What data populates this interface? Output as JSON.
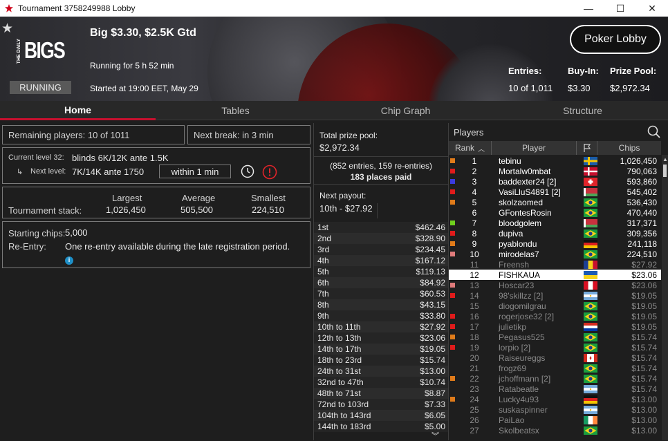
{
  "window": {
    "title": "Tournament 3758249988 Lobby",
    "minimize": "—",
    "maximize": "☐",
    "close": "✕"
  },
  "banner": {
    "brand_small": "THE DAILY",
    "brand_big": "BIGS",
    "status": "RUNNING",
    "title": "Big $3.30, $2.5K Gtd",
    "running_for": "Running for 5 h 52 min",
    "started": "Started at 19:00 EET, May 29",
    "lobby_button": "Poker Lobby",
    "entries_label": "Entries:",
    "entries_value": "10 of 1,011",
    "buyin_label": "Buy-In:",
    "buyin_value": "$3.30",
    "prize_label": "Prize Pool:",
    "prize_value": "$2,972.34"
  },
  "tabs": [
    "Home",
    "Tables",
    "Chip Graph",
    "Structure"
  ],
  "home": {
    "remaining": "Remaining players: 10 of 1011",
    "next_break": "Next break: in 3 min",
    "current_level_label": "Current level 32:",
    "current_level_value": "blinds 6K/12K ante 1.5K",
    "next_level_label": "Next level:",
    "next_level_value": "7K/14K ante 1750",
    "within": "within 1 min",
    "stack_header": {
      "largest": "Largest",
      "average": "Average",
      "smallest": "Smallest"
    },
    "stack_label": "Tournament stack:",
    "stack_values": {
      "largest": "1,026,450",
      "average": "505,500",
      "smallest": "224,510"
    },
    "starting_chips_label": "Starting chips:",
    "starting_chips_value": "5,000",
    "reentry_label": "Re-Entry:",
    "reentry_value": "One re-entry available during the late registration period."
  },
  "prize": {
    "total_label": "Total prize pool:",
    "total_value": "$2,972.34",
    "entries_note": "(852 entries, 159 re-entries)",
    "places_paid": "183 places paid",
    "next_payout_label": "Next payout:",
    "next_payout_value": "10th - $27.92",
    "list": [
      {
        "place": "1st",
        "amount": "$462.46"
      },
      {
        "place": "2nd",
        "amount": "$328.90"
      },
      {
        "place": "3rd",
        "amount": "$234.45"
      },
      {
        "place": "4th",
        "amount": "$167.12"
      },
      {
        "place": "5th",
        "amount": "$119.13"
      },
      {
        "place": "6th",
        "amount": "$84.92"
      },
      {
        "place": "7th",
        "amount": "$60.53"
      },
      {
        "place": "8th",
        "amount": "$43.15"
      },
      {
        "place": "9th",
        "amount": "$33.80"
      },
      {
        "place": "10th to 11th",
        "amount": "$27.92"
      },
      {
        "place": "12th to 13th",
        "amount": "$23.06"
      },
      {
        "place": "14th to 17th",
        "amount": "$19.05"
      },
      {
        "place": "18th to 23rd",
        "amount": "$15.74"
      },
      {
        "place": "24th to 31st",
        "amount": "$13.00"
      },
      {
        "place": "32nd to 47th",
        "amount": "$10.74"
      },
      {
        "place": "48th to 71st",
        "amount": "$8.87"
      },
      {
        "place": "72nd to 103rd",
        "amount": "$7.33"
      },
      {
        "place": "104th to 143rd",
        "amount": "$6.05"
      },
      {
        "place": "144th to 183rd",
        "amount": "$5.00"
      }
    ]
  },
  "players": {
    "header": "Players",
    "columns": {
      "rank": "Rank",
      "player": "Player",
      "chips": "Chips"
    },
    "rows": [
      {
        "rank": "1",
        "name": "tebinu",
        "chips": "1,026,450",
        "state": "act",
        "mark": "#e07b1a",
        "flag": "se"
      },
      {
        "rank": "2",
        "name": "Mortalw0mbat",
        "chips": "790,063",
        "state": "act",
        "mark": "#e01b1b",
        "flag": "dk"
      },
      {
        "rank": "3",
        "name": "baddexter24 [2]",
        "chips": "593,860",
        "state": "act",
        "mark": "#3a3ae0",
        "flag": "ch"
      },
      {
        "rank": "4",
        "name": "VasiLluS4891 [2]",
        "chips": "545,402",
        "state": "act",
        "mark": "#e01b1b",
        "flag": "by"
      },
      {
        "rank": "5",
        "name": "skolzaomed",
        "chips": "536,430",
        "state": "act",
        "mark": "#e07b1a",
        "flag": "br"
      },
      {
        "rank": "6",
        "name": "GFontesRosin",
        "chips": "470,440",
        "state": "act",
        "mark": "",
        "flag": "br"
      },
      {
        "rank": "7",
        "name": "bloodgolem",
        "chips": "317,371",
        "state": "act",
        "mark": "#6fd11d",
        "flag": "by"
      },
      {
        "rank": "8",
        "name": "dupiva",
        "chips": "309,356",
        "state": "act",
        "mark": "#e01b1b",
        "flag": "br"
      },
      {
        "rank": "9",
        "name": "pyablondu",
        "chips": "241,118",
        "state": "act",
        "mark": "#e07b1a",
        "flag": "de"
      },
      {
        "rank": "10",
        "name": "mirodelas7",
        "chips": "224,510",
        "state": "act",
        "mark": "#e07b7b",
        "flag": "br"
      },
      {
        "rank": "11",
        "name": "Freensh",
        "chips": "$27.92",
        "state": "out",
        "mark": "",
        "flag": "ro"
      },
      {
        "rank": "12",
        "name": "FISHKAUA",
        "chips": "$23.06",
        "state": "me",
        "mark": "",
        "flag": "ua"
      },
      {
        "rank": "13",
        "name": "Hoscar23",
        "chips": "$23.06",
        "state": "out",
        "mark": "#e07b7b",
        "flag": "pe"
      },
      {
        "rank": "14",
        "name": "98'skillzz [2]",
        "chips": "$19.05",
        "state": "out",
        "mark": "#e01b1b",
        "flag": "ar"
      },
      {
        "rank": "15",
        "name": "diogomilgrau",
        "chips": "$19.05",
        "state": "out",
        "mark": "",
        "flag": "br"
      },
      {
        "rank": "16",
        "name": "rogerjose32 [2]",
        "chips": "$19.05",
        "state": "out",
        "mark": "#e01b1b",
        "flag": "br"
      },
      {
        "rank": "17",
        "name": "julietikp",
        "chips": "$19.05",
        "state": "out",
        "mark": "#e01b1b",
        "flag": "py"
      },
      {
        "rank": "18",
        "name": "Pegasus525",
        "chips": "$15.74",
        "state": "out",
        "mark": "#e07b1a",
        "flag": "br"
      },
      {
        "rank": "19",
        "name": "lorpio [2]",
        "chips": "$15.74",
        "state": "out",
        "mark": "#e01b1b",
        "flag": "br"
      },
      {
        "rank": "20",
        "name": "Raiseureggs",
        "chips": "$15.74",
        "state": "out",
        "mark": "",
        "flag": "ca"
      },
      {
        "rank": "21",
        "name": "frogz69",
        "chips": "$15.74",
        "state": "out",
        "mark": "",
        "flag": "br"
      },
      {
        "rank": "22",
        "name": "jchoffmann [2]",
        "chips": "$15.74",
        "state": "out",
        "mark": "#e07b1a",
        "flag": "br"
      },
      {
        "rank": "23",
        "name": "Ratabeatle",
        "chips": "$15.74",
        "state": "out",
        "mark": "",
        "flag": "ar"
      },
      {
        "rank": "24",
        "name": "Lucky4u93",
        "chips": "$13.00",
        "state": "out",
        "mark": "#e07b1a",
        "flag": "de"
      },
      {
        "rank": "25",
        "name": "suskaspinner",
        "chips": "$13.00",
        "state": "out",
        "mark": "",
        "flag": "ar"
      },
      {
        "rank": "26",
        "name": "PaiLao",
        "chips": "$13.00",
        "state": "out",
        "mark": "",
        "flag": "ie"
      },
      {
        "rank": "27",
        "name": "Skolbeatsx",
        "chips": "$13.00",
        "state": "out",
        "mark": "",
        "flag": "br"
      }
    ]
  }
}
